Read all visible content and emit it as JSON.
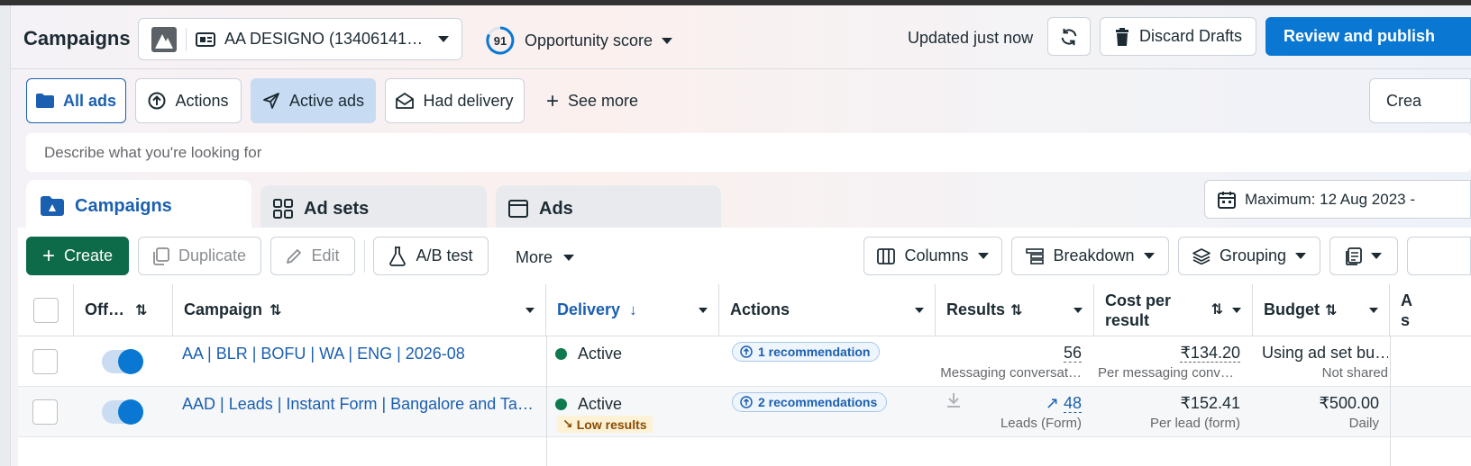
{
  "header": {
    "title": "Campaigns",
    "account": "AA DESIGNO (13406141…",
    "opportunity_score": "91",
    "opportunity_label": "Opportunity score",
    "updated": "Updated just now",
    "discard_label": "Discard Drafts",
    "review_label": "Review and publish"
  },
  "filters": {
    "all_ads": "All ads",
    "actions": "Actions",
    "active_ads": "Active ads",
    "had_delivery": "Had delivery",
    "see_more": "See more",
    "create_partial": "Crea"
  },
  "search": {
    "placeholder": "Describe what you're looking for"
  },
  "tabs": {
    "campaigns": "Campaigns",
    "ad_sets": "Ad sets",
    "ads": "Ads"
  },
  "date_range": "Maximum: 12 Aug 2023 -",
  "toolbar": {
    "create": "Create",
    "duplicate": "Duplicate",
    "edit": "Edit",
    "ab_test": "A/B test",
    "more": "More",
    "columns": "Columns",
    "breakdown": "Breakdown",
    "grouping": "Grouping"
  },
  "table": {
    "headers": {
      "off_on": "Off…",
      "campaign": "Campaign",
      "delivery": "Delivery",
      "actions": "Actions",
      "results": "Results",
      "cost_per_result": "Cost per result",
      "budget": "Budget",
      "partial_a": "A",
      "partial_s": "s"
    },
    "rows": [
      {
        "campaign": "AA | BLR | BOFU | WA | ENG | 2026-08",
        "delivery": "Active",
        "delivery_note": "",
        "actions": "1 recommendation",
        "results": "56",
        "results_sub": "Messaging conversat…",
        "cost": "₹134.20",
        "cost_sub": "Per messaging conve…",
        "budget": "Using ad set bu…",
        "budget_sub": "Not shared"
      },
      {
        "campaign": "AAD | Leads | Instant Form | Bangalore and Tamil …",
        "delivery": "Active",
        "delivery_note": "Low results",
        "actions": "2 recommendations",
        "results": "48",
        "results_sub": "Leads (Form)",
        "cost": "₹152.41",
        "cost_sub": "Per lead (form)",
        "budget": "₹500.00",
        "budget_sub": "Daily"
      }
    ]
  },
  "colors": {
    "accent": "#0a78d2",
    "create": "#0e6b4a",
    "active": "#0e7a4e",
    "link": "#1b5fb0"
  }
}
